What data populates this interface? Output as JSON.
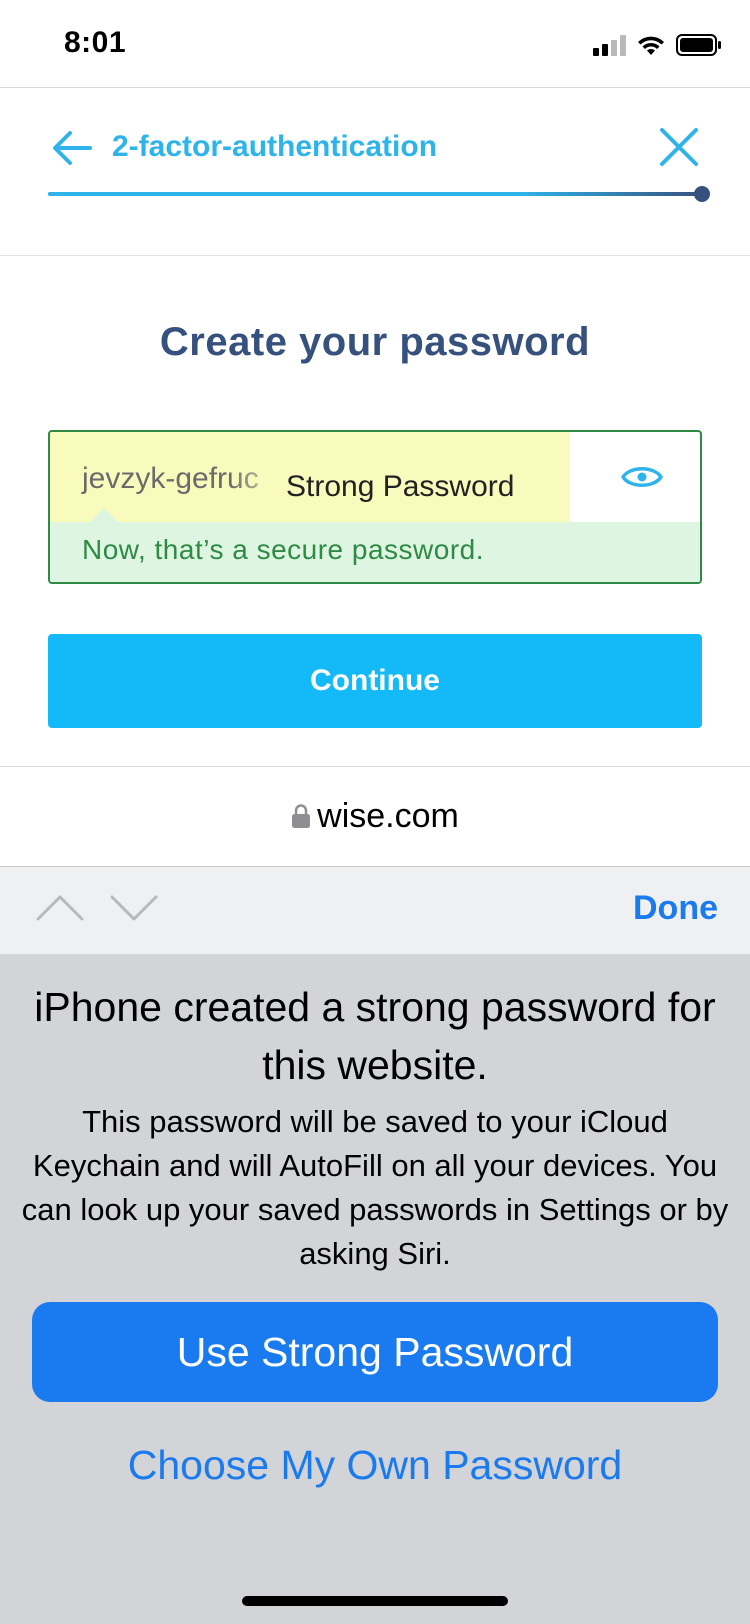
{
  "status_bar": {
    "time": "8:01"
  },
  "header": {
    "title": "2-factor-authentication",
    "progress_fraction": 1.0
  },
  "main": {
    "title": "Create your password",
    "password_value": "jevzyk-gefruc",
    "strong_password_label": "Strong Password",
    "validation_message": "Now, that’s a secure password.",
    "continue_label": "Continue"
  },
  "browser": {
    "domain": "wise.com"
  },
  "toolbar": {
    "done_label": "Done"
  },
  "password_sheet": {
    "title": "iPhone created a strong password for this website.",
    "body": "This password will be saved to your iCloud Keychain and will AutoFill on all your devices. You can look up your saved passwords in Settings or by asking Siri.",
    "use_strong_label": "Use Strong Password",
    "choose_own_label": "Choose My Own Password"
  },
  "colors": {
    "brand_blue": "#2eb4ea",
    "brand_navy": "#37517e",
    "continue_blue": "#14b9f8",
    "success_green": "#2f8a45",
    "ios_blue": "#1a7af0"
  },
  "icons": {
    "back": "back-arrow-icon",
    "close": "close-icon",
    "eye": "eye-icon",
    "lock": "lock-icon",
    "prev": "chevron-up-icon",
    "next": "chevron-down-icon"
  }
}
